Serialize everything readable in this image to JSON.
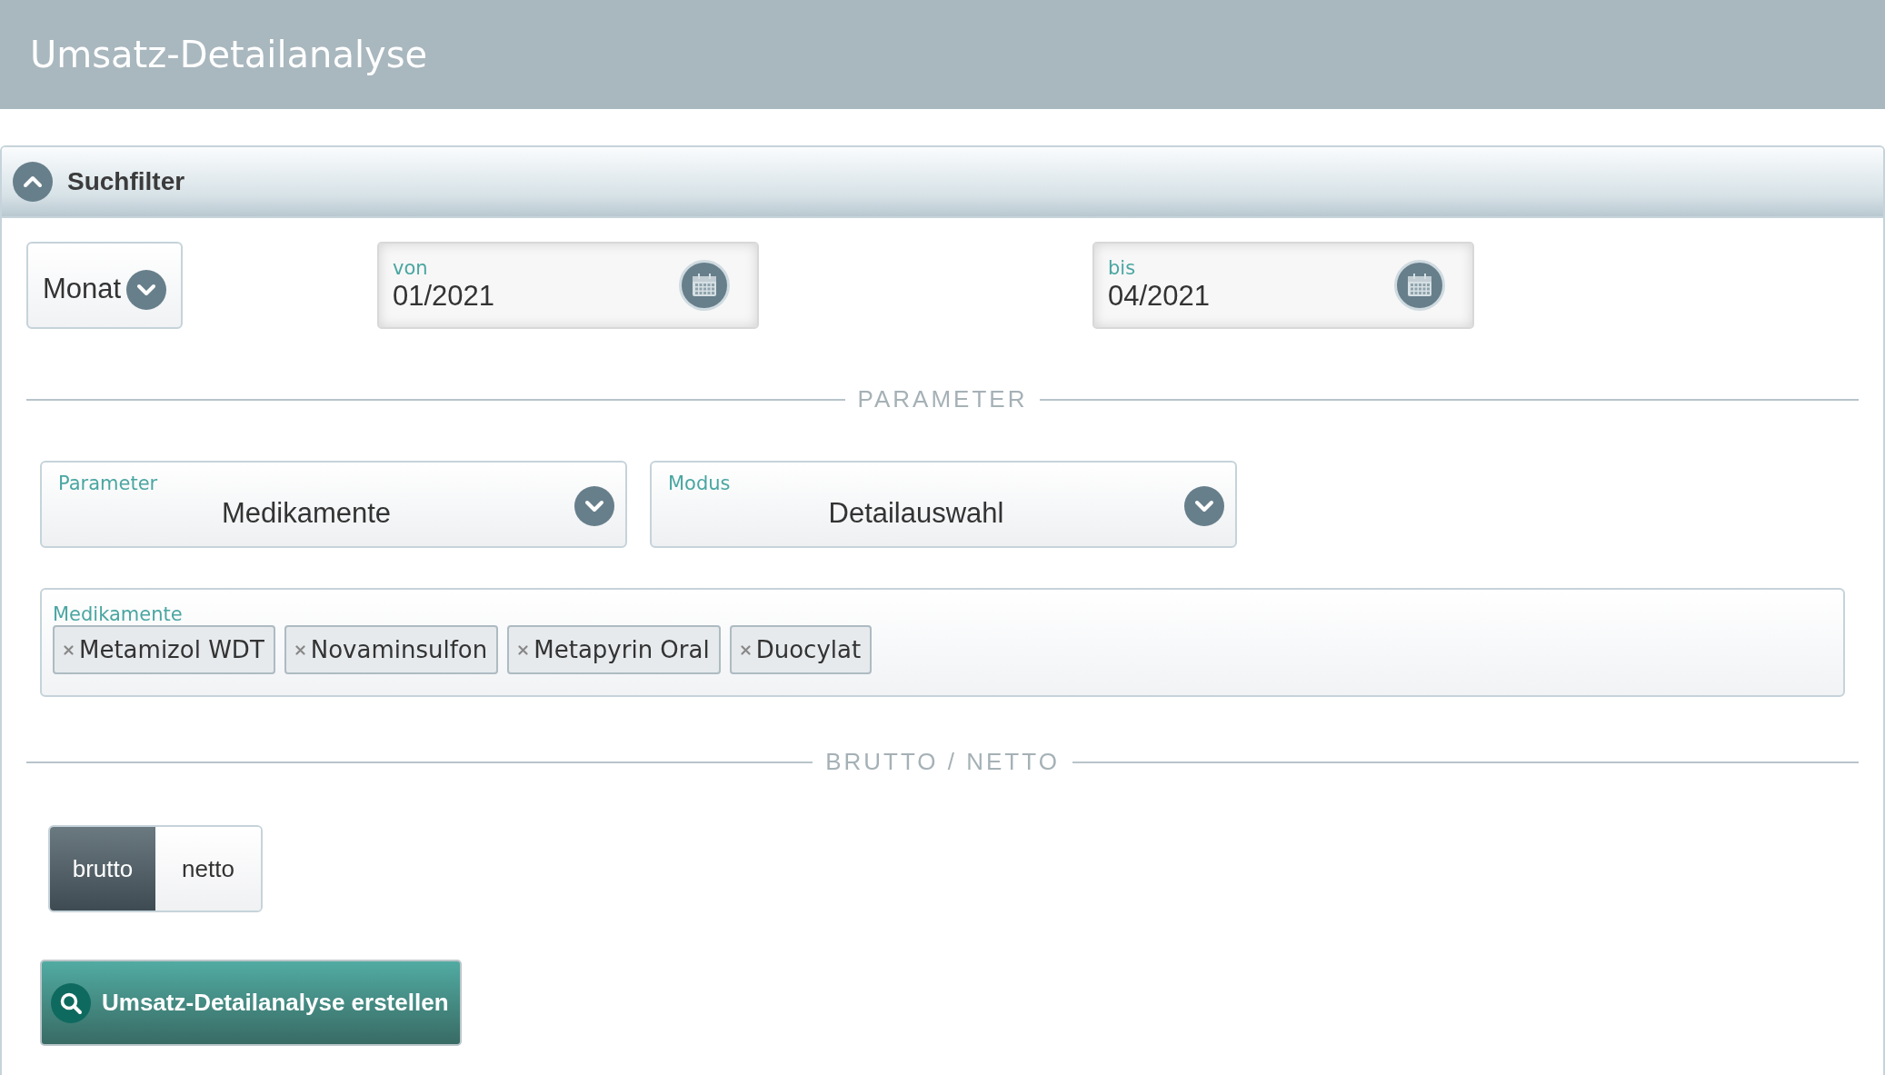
{
  "header": {
    "title": "Umsatz-Detailanalyse"
  },
  "panel": {
    "title": "Suchfilter",
    "expanded": true
  },
  "period": {
    "unit": "Monat",
    "from": {
      "label": "von",
      "value": "01/2021"
    },
    "to": {
      "label": "bis",
      "value": "04/2021"
    }
  },
  "sections": [
    "PARAMETER",
    "BRUTTO / NETTO"
  ],
  "selects": [
    {
      "label": "Parameter",
      "value": "Medikamente"
    },
    {
      "label": "Modus",
      "value": "Detailauswahl"
    }
  ],
  "tags_field": {
    "label": "Medikamente",
    "tags": [
      "Metamizol WDT",
      "Novaminsulfon",
      "Metapyrin Oral",
      "Duocylat"
    ]
  },
  "toggle": [
    {
      "label": "brutto",
      "selected": true
    },
    {
      "label": "netto",
      "selected": false
    }
  ],
  "submit": {
    "label": "Umsatz-Detailanalyse erstellen"
  }
}
